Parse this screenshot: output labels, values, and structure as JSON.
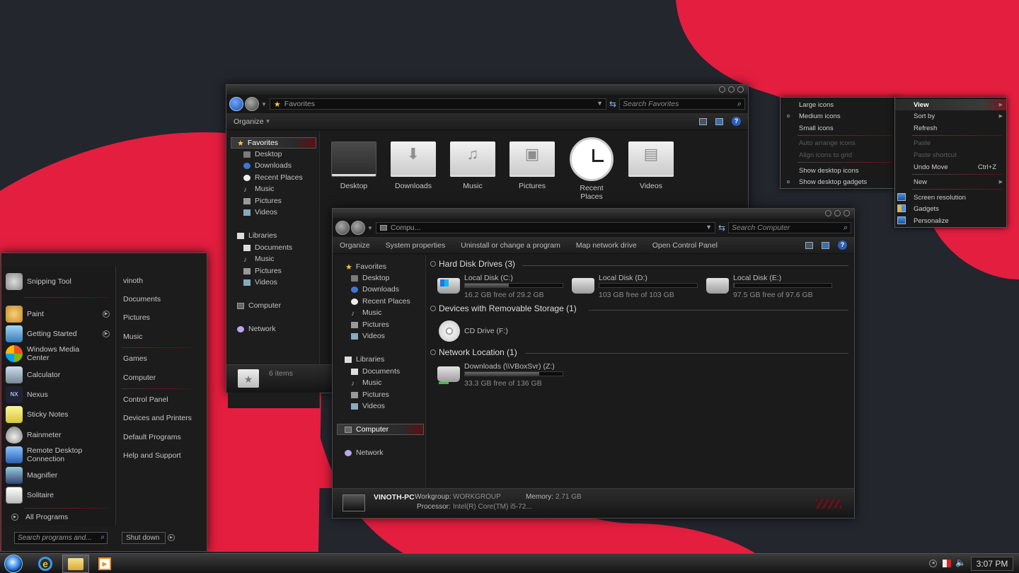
{
  "favorites_window": {
    "address": "Favorites",
    "search_placeholder": "Search Favorites",
    "organize": "Organize",
    "nav": {
      "favorites": "Favorites",
      "items": [
        "Desktop",
        "Downloads",
        "Recent Places",
        "Music",
        "Pictures",
        "Videos"
      ],
      "libraries": "Libraries",
      "lib_items": [
        "Documents",
        "Music",
        "Pictures",
        "Videos"
      ],
      "computer": "Computer",
      "network": "Network"
    },
    "content": [
      "Desktop",
      "Downloads",
      "Music",
      "Pictures",
      "Recent Places",
      "Videos"
    ],
    "status": "6 items"
  },
  "computer_window": {
    "address": "Compu...",
    "search_placeholder": "Search Computer",
    "commands": [
      "Organize",
      "System properties",
      "Uninstall or change a program",
      "Map network drive",
      "Open Control Panel"
    ],
    "nav": {
      "favorites": "Favorites",
      "items": [
        "Desktop",
        "Downloads",
        "Recent Places",
        "Music",
        "Pictures",
        "Videos"
      ],
      "libraries": "Libraries",
      "lib_items": [
        "Documents",
        "Music",
        "Pictures",
        "Videos"
      ],
      "computer": "Computer",
      "network": "Network"
    },
    "sections": {
      "hdd": "Hard Disk Drives (3)",
      "removable": "Devices with Removable Storage (1)",
      "network": "Network Location (1)"
    },
    "drives": [
      {
        "name": "Local Disk (C:)",
        "free": "16.2 GB free of 29.2 GB",
        "used_fraction": 0.45
      },
      {
        "name": "Local Disk (D:)",
        "free": "103 GB free of 103 GB",
        "used_fraction": 0.0
      },
      {
        "name": "Local Disk (E:)",
        "free": "97.5 GB free of 97.6 GB",
        "used_fraction": 0.01
      }
    ],
    "cd": "CD Drive (F:)",
    "netdrive": {
      "name": "Downloads (\\\\VBoxSvr) (Z:)",
      "free": "33.3 GB free of 136 GB",
      "used_fraction": 0.76
    },
    "status": {
      "pc": "VINOTH-PC",
      "workgroup_label": "Workgroup:",
      "workgroup": "WORKGROUP",
      "memory_label": "Memory:",
      "memory": "2.71 GB",
      "processor_label": "Processor:",
      "processor": "Intel(R) Core(TM) i5-72..."
    }
  },
  "view_submenu": [
    {
      "label": "Large icons",
      "disabled": false
    },
    {
      "label": "Medium icons",
      "disabled": false
    },
    {
      "label": "Small icons",
      "disabled": false
    },
    {
      "label": "Auto arrange icons",
      "disabled": true
    },
    {
      "label": "Align icons to grid",
      "disabled": true
    },
    {
      "label": "Show desktop icons",
      "disabled": false
    },
    {
      "label": "Show desktop gadgets",
      "disabled": false
    }
  ],
  "context_menu": {
    "view": "View",
    "sort_by": "Sort by",
    "refresh": "Refresh",
    "paste": "Paste",
    "paste_shortcut": "Paste shortcut",
    "undo_move": "Undo Move",
    "undo_shortcut": "Ctrl+Z",
    "new": "New",
    "screen_resolution": "Screen resolution",
    "gadgets": "Gadgets",
    "personalize": "Personalize"
  },
  "start_menu": {
    "programs": [
      {
        "label": "Snipping Tool",
        "icon": "scissors-icon",
        "arrow": false
      },
      {
        "label": "Paint",
        "icon": "paint-palette-icon",
        "arrow": true
      },
      {
        "label": "Getting Started",
        "icon": "getting-started-icon",
        "arrow": true
      },
      {
        "label": "Windows Media Center",
        "icon": "media-center-icon",
        "arrow": false
      },
      {
        "label": "Calculator",
        "icon": "calculator-icon",
        "arrow": false
      },
      {
        "label": "Nexus",
        "icon": "nexus-icon",
        "arrow": false
      },
      {
        "label": "Sticky Notes",
        "icon": "sticky-notes-icon",
        "arrow": false
      },
      {
        "label": "Rainmeter",
        "icon": "rainmeter-icon",
        "arrow": false
      },
      {
        "label": "Remote Desktop Connection",
        "icon": "remote-desktop-icon",
        "arrow": false
      },
      {
        "label": "Magnifier",
        "icon": "magnifier-icon",
        "arrow": false
      },
      {
        "label": "Solitaire",
        "icon": "solitaire-icon",
        "arrow": false
      }
    ],
    "all_programs": "All Programs",
    "right": [
      "vinoth",
      "Documents",
      "Pictures",
      "Music",
      "Games",
      "Computer",
      "Control Panel",
      "Devices and Printers",
      "Default Programs",
      "Help and Support"
    ],
    "search_placeholder": "Search programs and...",
    "shutdown": "Shut down"
  },
  "taskbar": {
    "clock": "3:07 PM"
  },
  "colors": {
    "wallpaper_dark": "#23262d",
    "wallpaper_red": "#e41e3f",
    "accent_blue": "#3b78d6"
  }
}
